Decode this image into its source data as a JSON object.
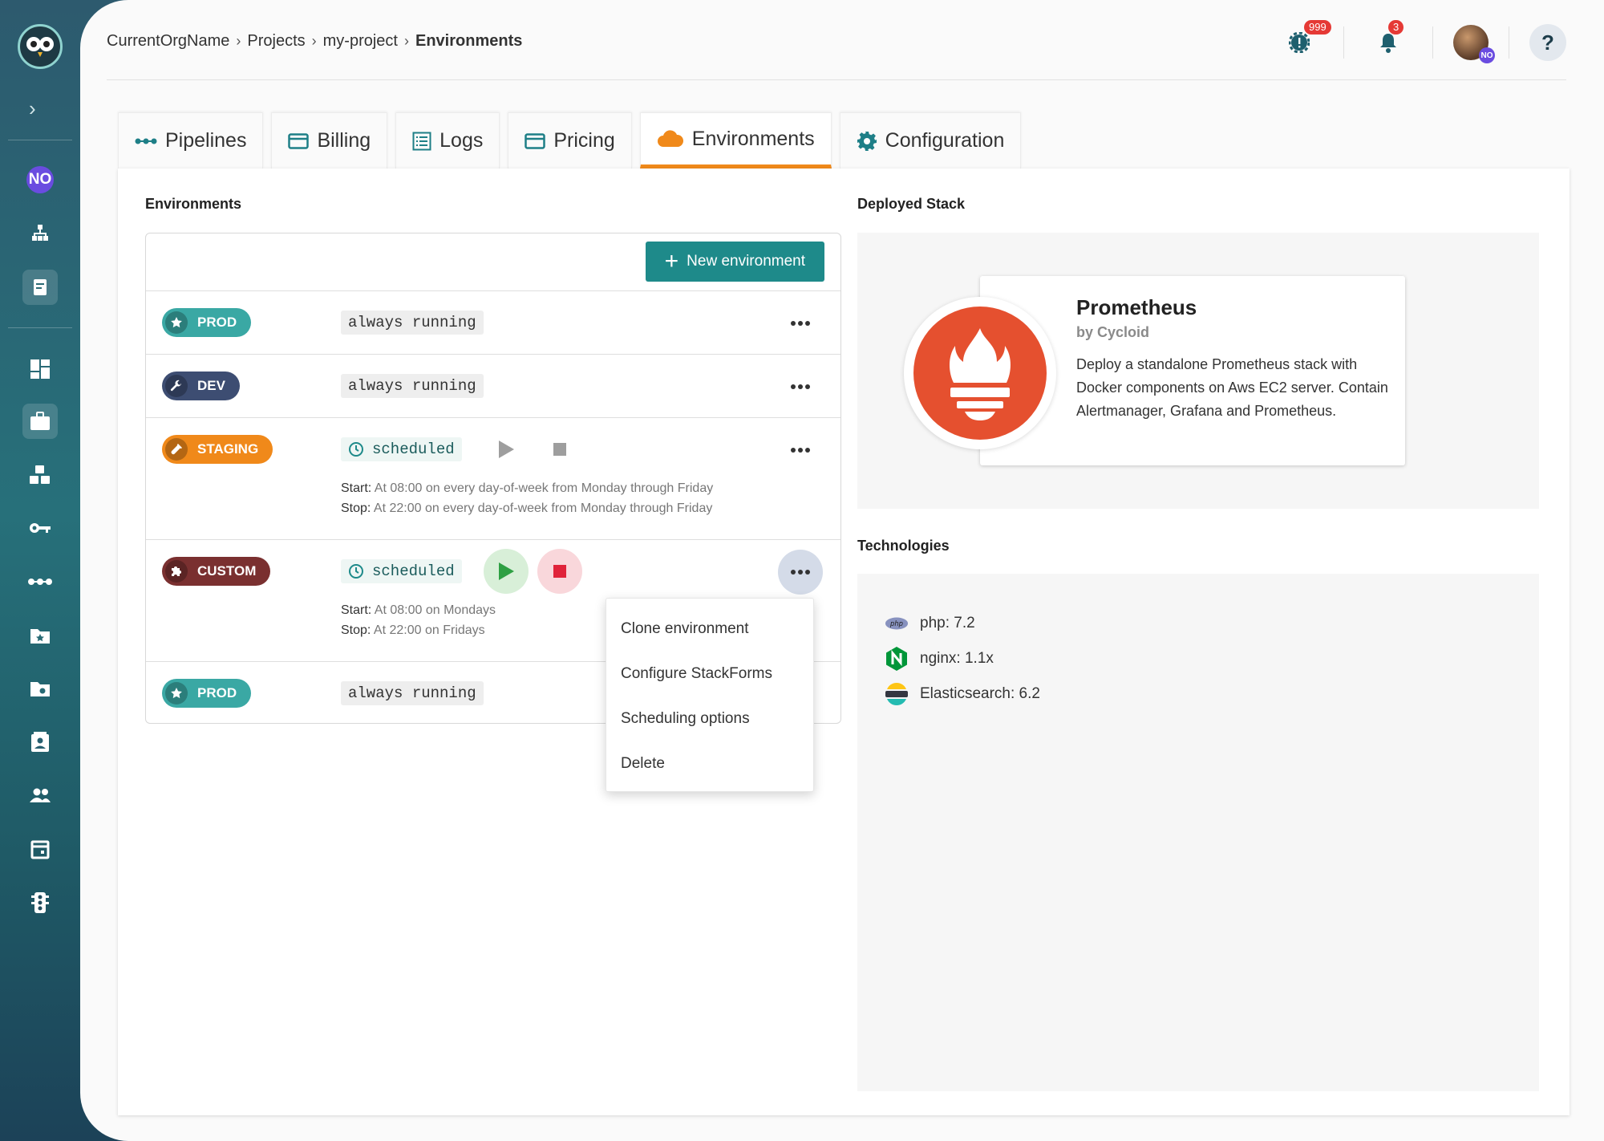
{
  "breadcrumb": {
    "org": "CurrentOrgName",
    "projects": "Projects",
    "project": "my-project",
    "current": "Environments"
  },
  "header": {
    "events_badge": "999",
    "notifications_badge": "3",
    "avatar_initials": "NO",
    "help_label": "?"
  },
  "sidebar": {
    "org_initials": "NO"
  },
  "tabs": [
    {
      "label": "Pipelines"
    },
    {
      "label": "Billing"
    },
    {
      "label": "Logs"
    },
    {
      "label": "Pricing"
    },
    {
      "label": "Environments"
    },
    {
      "label": "Configuration"
    }
  ],
  "environments": {
    "title": "Environments",
    "new_button": "New environment",
    "rows": [
      {
        "name": "PROD",
        "color": "#3aa8a4",
        "mode": "always running"
      },
      {
        "name": "DEV",
        "color": "#3d4d72",
        "mode": "always running"
      },
      {
        "name": "STAGING",
        "color": "#f0891a",
        "mode": "scheduled",
        "start_label": "Start:",
        "start": "At 08:00 on every day-of-week from Monday through Friday",
        "stop_label": "Stop:",
        "stop": "At 22:00 on every day-of-week from Monday through Friday"
      },
      {
        "name": "CUSTOM",
        "color": "#7a3030",
        "mode": "scheduled",
        "start_label": "Start:",
        "start": "At 08:00 on Mondays",
        "stop_label": "Stop:",
        "stop": "At 22:00 on Fridays"
      },
      {
        "name": "PROD",
        "color": "#3aa8a4",
        "mode": "always running"
      }
    ]
  },
  "menu": {
    "items": [
      "Clone environment",
      "Configure StackForms",
      "Scheduling options",
      "Delete"
    ]
  },
  "stack": {
    "title": "Deployed Stack",
    "name": "Prometheus",
    "by": "by Cycloid",
    "description": "Deploy a standalone Prometheus stack with Docker components on Aws EC2 server. Contain Alertmanager, Grafana and Prometheus."
  },
  "technologies": {
    "title": "Technologies",
    "items": [
      "php: 7.2",
      "nginx: 1.1x",
      "Elasticsearch: 6.2"
    ]
  }
}
